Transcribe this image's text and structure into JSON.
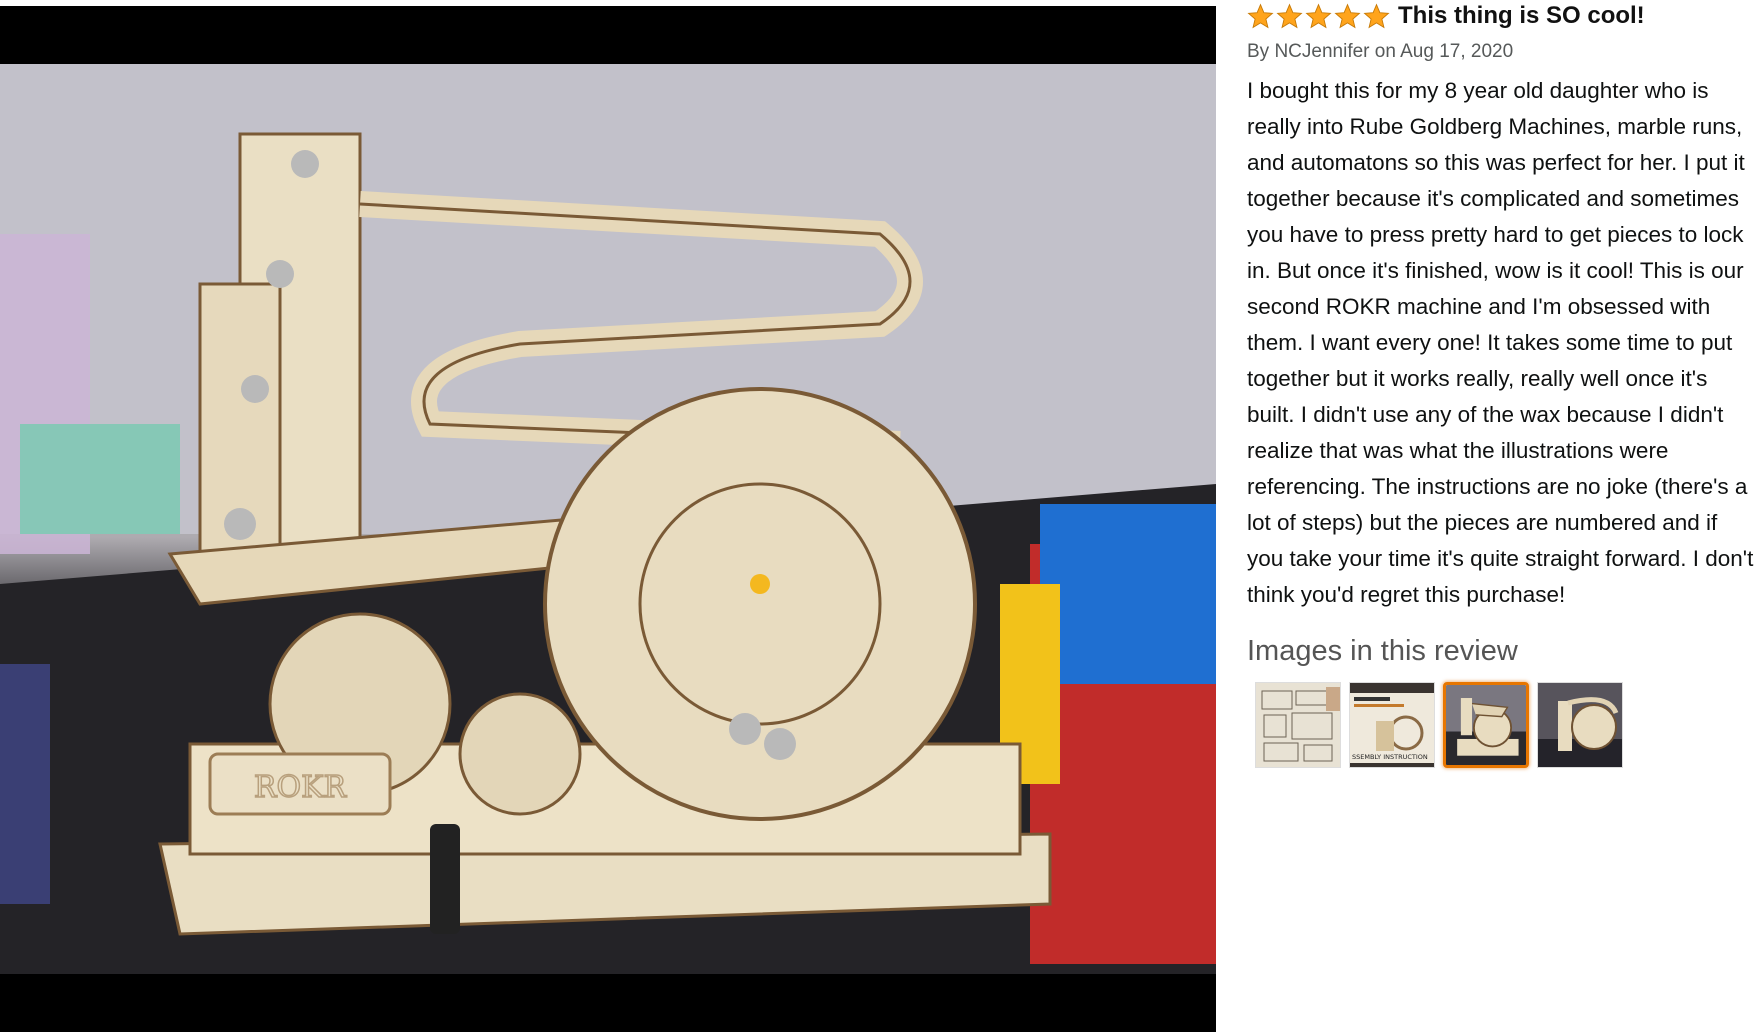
{
  "photo": {
    "alt": ""
  },
  "review": {
    "rating": 5,
    "title": "This thing is SO cool!",
    "byline": "By NCJennifer on Aug 17, 2020",
    "body": "I bought this for my 8 year old daughter who is really into Rube Goldberg Machines, marble runs, and automatons so this was perfect for her. I put it together because it's complicated and sometimes you have to press pretty hard to get pieces to lock in. But once it's finished, wow is it cool! This is our second ROKR machine and I'm obsessed with them. I want every one! It takes some time to put together but it works really, really well once it's built. I didn't use any of the wax because I didn't realize that was what the illustrations were referencing. The instructions are no joke (there's a lot of steps) but the pieces are numbered and if you take your time it's quite straight forward. I don't think you'd regret this purchase!"
  },
  "images_section": {
    "heading": "Images in this review",
    "selected_index": 2,
    "thumbnails": [
      {
        "icon": "instructions-sheet-thumbnail"
      },
      {
        "icon": "manual-cover-thumbnail",
        "caption": "SSEMBLY INSTRUCTION"
      },
      {
        "icon": "marble-run-thumbnail"
      },
      {
        "icon": "marble-run-side-thumbnail"
      }
    ]
  },
  "photo_labels": {
    "brand": "ROKR"
  },
  "colors": {
    "star": "#FFA41C",
    "selected_border": "#e77600",
    "wood": "#e8dcc0"
  }
}
